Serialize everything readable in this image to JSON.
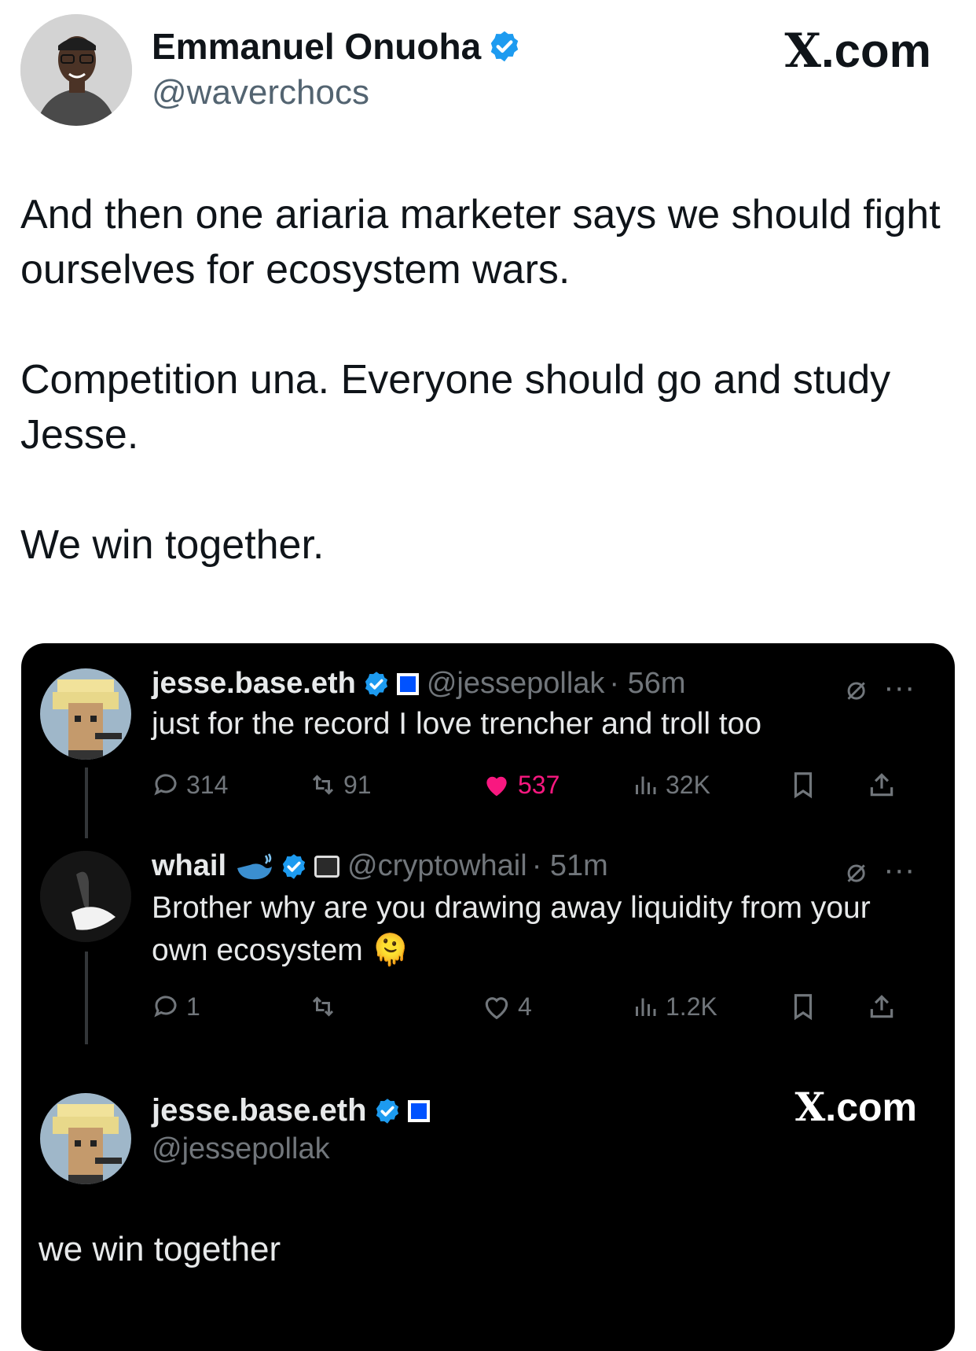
{
  "author": {
    "name": "Emmanuel Onuoha",
    "handle": "@waverchocs",
    "verified": true
  },
  "brand": {
    "x_glyph": "X",
    "domain_suffix": ".com"
  },
  "tweet": {
    "paragraphs": [
      "And then one ariaria marketer says we should fight ourselves for ecosystem wars.",
      "Competition una. Everyone should go and study Jesse.",
      "We win together."
    ]
  },
  "quote": {
    "posts": [
      {
        "name": "jesse.base.eth",
        "handle": "@jessepollak",
        "time": "· 56m",
        "text": "just for the record I love trencher and troll too",
        "replies": "314",
        "reposts": "91",
        "likes": "537",
        "views": "32K",
        "liked": true
      },
      {
        "name": "whail",
        "handle": "@cryptowhail",
        "time": "· 51m",
        "text": "Brother why are you drawing away liquidity from your own ecosystem",
        "emoji": "🫠",
        "replies": "1",
        "reposts": "",
        "likes": "4",
        "views": "1.2K",
        "liked": false
      }
    ],
    "final_card": {
      "name": "jesse.base.eth",
      "handle": "@jessepollak",
      "text": "we win together"
    }
  },
  "colors": {
    "verified_blue": "#1d9bf0",
    "like_pink": "#f91880",
    "base_blue": "#0052ff"
  },
  "icons": [
    "verified-badge-icon",
    "reply-icon",
    "repost-icon",
    "like-icon",
    "views-icon",
    "bookmark-icon",
    "share-icon",
    "grok-icon",
    "more-icon",
    "whale-icon"
  ]
}
